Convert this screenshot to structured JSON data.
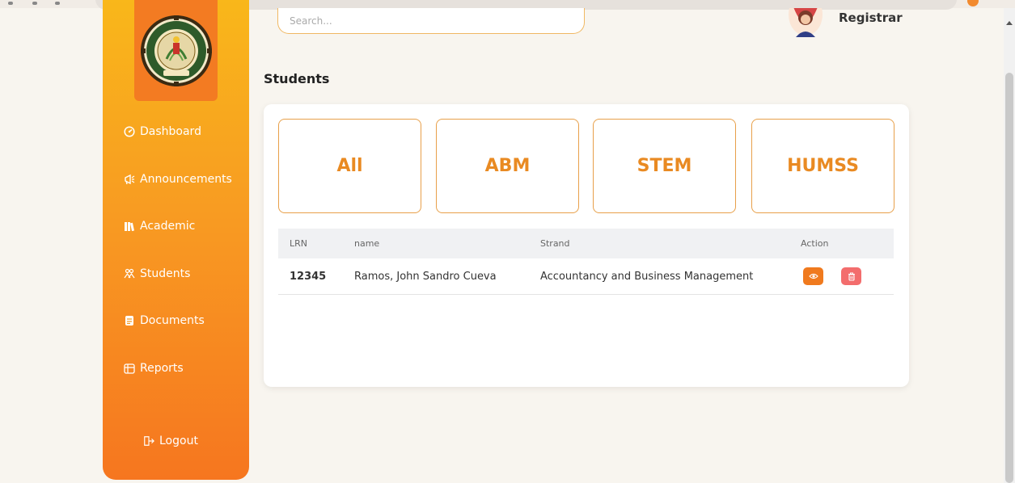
{
  "search": {
    "placeholder": "Search..."
  },
  "user": {
    "role": "Registrar"
  },
  "sidebar": {
    "items": [
      {
        "label": "Dashboard",
        "icon": "dashboard-icon"
      },
      {
        "label": "Announcements",
        "icon": "megaphone-icon"
      },
      {
        "label": "Academic",
        "icon": "books-icon"
      },
      {
        "label": "Students",
        "icon": "people-icon"
      },
      {
        "label": "Documents",
        "icon": "document-icon"
      },
      {
        "label": "Reports",
        "icon": "reports-icon"
      }
    ],
    "logout": "Logout"
  },
  "page": {
    "title": "Students"
  },
  "filters": [
    "All",
    "ABM",
    "STEM",
    "HUMSS"
  ],
  "table": {
    "headers": {
      "lrn": "LRN",
      "name": "name",
      "strand": "Strand",
      "action": "Action"
    },
    "rows": [
      {
        "lrn": "12345",
        "name": "Ramos, John Sandro Cueva",
        "strand": "Accountancy and Business Management"
      }
    ]
  },
  "colors": {
    "accent": "#f37b22",
    "sidebar_top": "#f9b71a",
    "sidebar_bottom": "#f6761f",
    "delete": "#f36d6d"
  }
}
